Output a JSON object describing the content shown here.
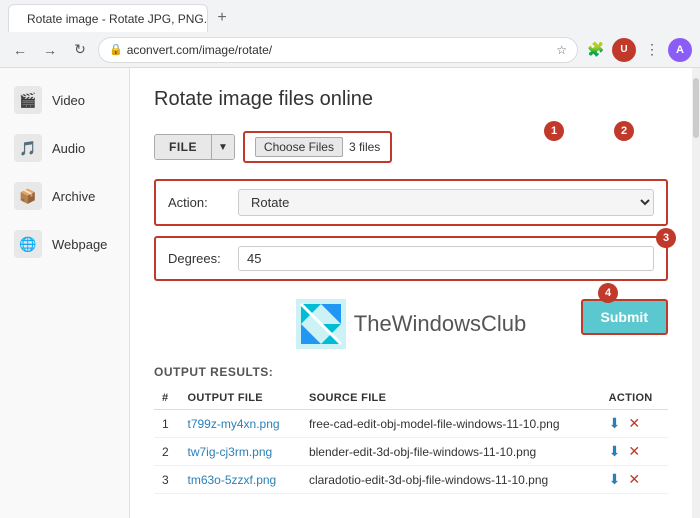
{
  "browser": {
    "tab_title": "Rotate image - Rotate JPG, PNG...",
    "url": "aconvert.com/image/rotate/",
    "new_tab_label": "+"
  },
  "sidebar": {
    "items": [
      {
        "id": "video",
        "label": "Video",
        "icon": "🎬"
      },
      {
        "id": "audio",
        "label": "Audio",
        "icon": "🎵"
      },
      {
        "id": "archive",
        "label": "Archive",
        "icon": "📦"
      },
      {
        "id": "webpage",
        "label": "Webpage",
        "icon": "🌐"
      }
    ]
  },
  "page": {
    "title": "Rotate image files online",
    "file_btn_label": "FILE",
    "choose_files_label": "Choose Files",
    "files_count": "3 files",
    "action_label": "Action:",
    "action_value": "Rotate",
    "action_placeholder": "Rotate",
    "degrees_label": "Degrees:",
    "degrees_value": "45",
    "submit_label": "Submit",
    "output_label": "OUTPUT RESULTS:",
    "table_headers": [
      "#",
      "OUTPUT FILE",
      "SOURCE FILE",
      "ACTION"
    ],
    "table_rows": [
      {
        "num": "1",
        "output_file": "t799z-my4xn.png",
        "source_file": "free-cad-edit-obj-model-file-windows-11-10.png"
      },
      {
        "num": "2",
        "output_file": "tw7ig-cj3rm.png",
        "source_file": "blender-edit-3d-obj-file-windows-11-10.png"
      },
      {
        "num": "3",
        "output_file": "tm63o-5zzxf.png",
        "source_file": "claradotio-edit-3d-obj-file-windows-11-10.png"
      }
    ],
    "badges": [
      "1",
      "2",
      "3",
      "4"
    ],
    "watermark_text": "TheWindowsClub"
  },
  "colors": {
    "accent_red": "#c0392b",
    "link_blue": "#2980b9",
    "submit_bg": "#5bc8d0"
  }
}
